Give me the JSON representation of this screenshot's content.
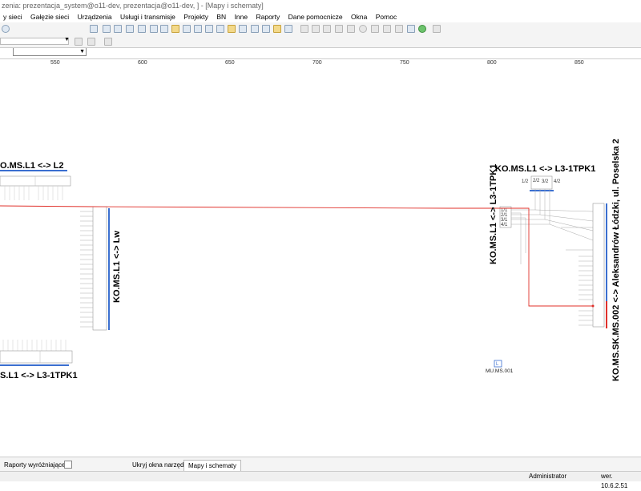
{
  "window": {
    "title": "zenia: prezentacja_system@o11-dev, prezentacja@o11-dev, ] - [Mapy i schematy]"
  },
  "menu": [
    "y sieci",
    "Gałęzie sieci",
    "Urządzenia",
    "Usługi i transmisje",
    "Projekty",
    "BN",
    "Inne",
    "Raporty",
    "Dane pomocnicze",
    "Okna",
    "Pomoc"
  ],
  "ruler": {
    "ticks": [
      "550",
      "600",
      "650",
      "700",
      "750",
      "800",
      "850"
    ]
  },
  "schematic": {
    "labels": {
      "l2": "O.MS.L1 <-> L2",
      "lw": "KO.MS.L1 <-> Lw",
      "tpk_bottom": "S.L1 <-> L3-1TPK1",
      "tpk_top": "KO.MS.L1 <-> L3-1TPK1",
      "tpk_vertical": "KO.MS.L1 <-> L3-1TPK1",
      "long": "KO.MS.SK.MS.002 <-> Aleksandrów Łódzki, ul. Poselska 2",
      "mu": "MU.MS.001",
      "ports": [
        "1/2",
        "2/2",
        "3/2",
        "4/2"
      ],
      "port_rows": [
        "1/1",
        "2/1",
        "3/1",
        "4/1"
      ],
      "mu_icon": "L"
    }
  },
  "bottombar": {
    "raporty": "Raporty wyróżniające",
    "ukryj": "Ukryj okna narzędzi",
    "mapy": "Mapy i schematy"
  },
  "status": {
    "user": "Administrator",
    "version": "wer. 10.6.2.51"
  },
  "colors": {
    "accent": "#3b6fd0",
    "red": "#e0302a"
  }
}
